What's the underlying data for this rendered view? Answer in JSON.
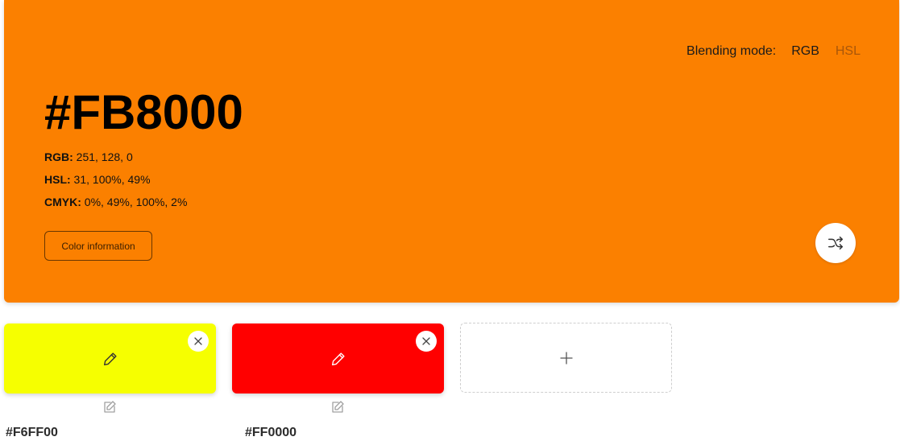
{
  "result": {
    "hex": "#FB8000",
    "color": "#FB8000",
    "rgb_label": "RGB:",
    "rgb_value": " 251, 128, 0",
    "hsl_label": "HSL:",
    "hsl_value": " 31, 100%, 49%",
    "cmyk_label": "CMYK:",
    "cmyk_value": " 0%, 49%, 100%, 2%",
    "info_button": "Color information",
    "shuffle_icon": "shuffle-icon"
  },
  "blending": {
    "label": "Blending mode:",
    "modes": [
      "RGB",
      "HSL"
    ],
    "active": "RGB"
  },
  "swatches": [
    {
      "hex": "#F6FF00",
      "color": "#F6FF00"
    },
    {
      "hex": "#FF0000",
      "color": "#FF0000"
    }
  ],
  "add_swatch": {
    "icon": "plus-icon"
  }
}
